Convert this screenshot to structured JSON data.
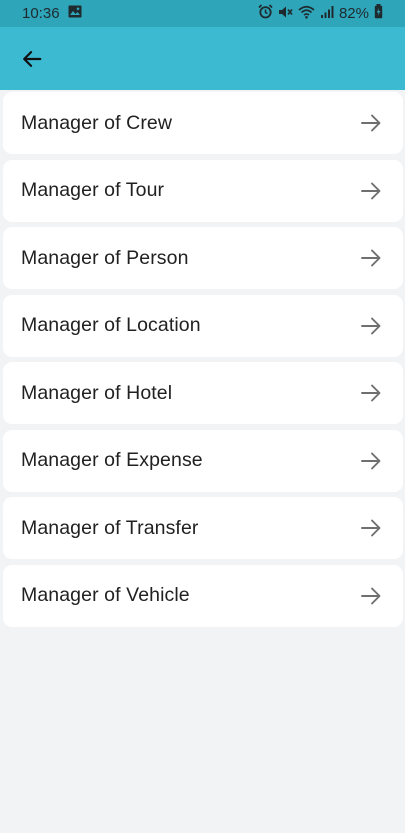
{
  "status_bar": {
    "time": "10:36",
    "battery": "82%",
    "icons": [
      "image-icon",
      "alarm-icon",
      "mute-icon",
      "wifi-icon",
      "signal-icon",
      "battery-icon"
    ]
  },
  "app_bar": {
    "back_icon": "arrow-left-icon",
    "color": "#3bbad1"
  },
  "list": {
    "items": [
      {
        "label": "Manager of Crew"
      },
      {
        "label": "Manager of Tour"
      },
      {
        "label": "Manager of Person"
      },
      {
        "label": "Manager of Location"
      },
      {
        "label": "Manager of Hotel"
      },
      {
        "label": "Manager of Expense"
      },
      {
        "label": "Manager of Transfer"
      },
      {
        "label": "Manager of Vehicle"
      }
    ],
    "item_icon": "arrow-right-icon"
  }
}
